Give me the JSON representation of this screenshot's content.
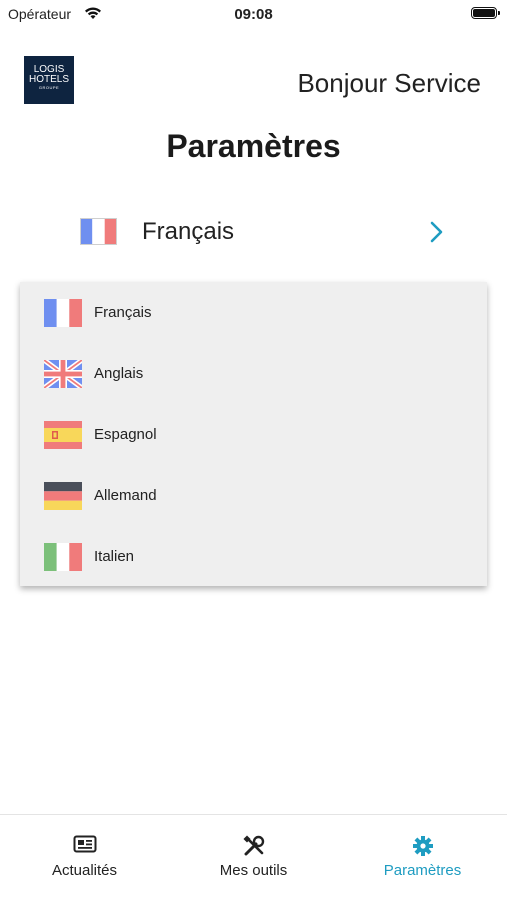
{
  "status_bar": {
    "carrier": "Opérateur",
    "time": "09:08"
  },
  "header": {
    "logo": {
      "line1": "LOGIS",
      "line2": "HOTELS",
      "line3": "GROUPE"
    },
    "greeting": "Bonjour Service"
  },
  "page": {
    "title": "Paramètres"
  },
  "language_selector": {
    "selected": "Français"
  },
  "language_options": [
    {
      "label": "Français",
      "flag": "flag-france-icon"
    },
    {
      "label": "Anglais",
      "flag": "flag-uk-icon"
    },
    {
      "label": "Espagnol",
      "flag": "flag-spain-icon"
    },
    {
      "label": "Allemand",
      "flag": "flag-germany-icon"
    },
    {
      "label": "Italien",
      "flag": "flag-italy-icon"
    }
  ],
  "tab_bar": {
    "tabs": [
      {
        "label": "Actualités",
        "icon": "newspaper-icon"
      },
      {
        "label": "Mes outils",
        "icon": "tools-icon"
      },
      {
        "label": "Paramètres",
        "icon": "gear-icon",
        "active": true
      }
    ]
  },
  "colors": {
    "accent": "#1e9cc1",
    "logo_bg": "#0e2440",
    "dropdown_bg": "#efefef"
  }
}
